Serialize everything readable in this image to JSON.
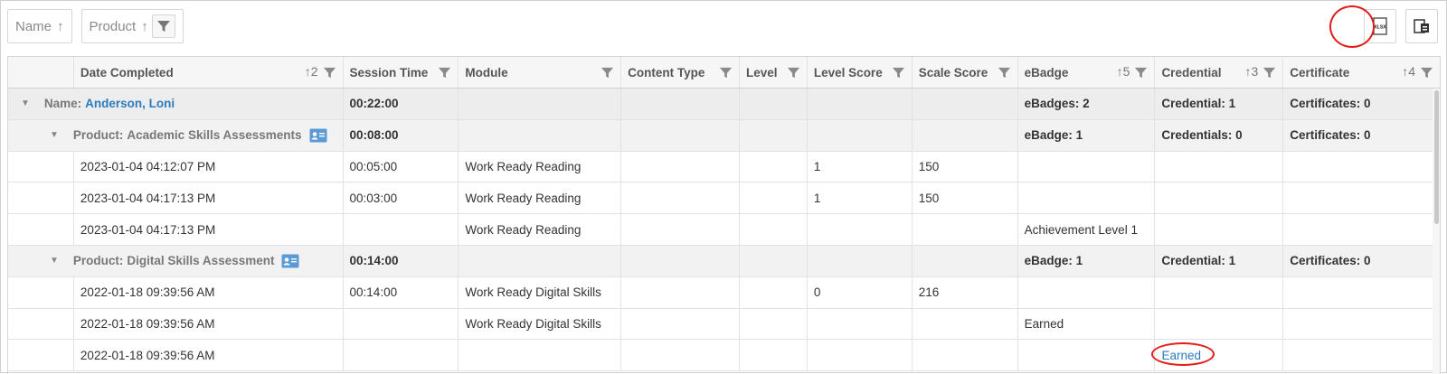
{
  "toolbar": {
    "group_chips": [
      {
        "label": "Name",
        "sort": "↑"
      },
      {
        "label": "Product",
        "sort": "↑"
      }
    ],
    "export_xlsx_label": "XLSX",
    "accent_circle_color": "#e31b1b"
  },
  "grid": {
    "columns": [
      {
        "label": "Date Completed",
        "sort": "↑2"
      },
      {
        "label": "Session Time",
        "sort": ""
      },
      {
        "label": "Module",
        "sort": ""
      },
      {
        "label": "Content Type",
        "sort": ""
      },
      {
        "label": "Level",
        "sort": ""
      },
      {
        "label": "Level Score",
        "sort": ""
      },
      {
        "label": "Scale Score",
        "sort": ""
      },
      {
        "label": "eBadge",
        "sort": "↑5"
      },
      {
        "label": "Credential",
        "sort": "↑3"
      },
      {
        "label": "Certificate",
        "sort": "↑4"
      }
    ],
    "name_group": {
      "prefix": "Name: ",
      "value": "Anderson, Loni",
      "session_time": "00:22:00",
      "ebadge": "eBadges: 2",
      "credential": "Credential: 1",
      "certificate": "Certificates: 0"
    },
    "product_groups": [
      {
        "prefix": "Product: ",
        "value": "Academic Skills Assessments",
        "session_time": "00:08:00",
        "ebadge": "eBadge: 1",
        "credential": "Credentials: 0",
        "certificate": "Certificates: 0",
        "rows": [
          {
            "date": "2023-01-04 04:12:07 PM",
            "session_time": "00:05:00",
            "module": "Work Ready Reading",
            "content_type": "",
            "level": "",
            "level_score": "1",
            "scale_score": "150",
            "ebadge": "",
            "credential": "",
            "certificate": ""
          },
          {
            "date": "2023-01-04 04:17:13 PM",
            "session_time": "00:03:00",
            "module": "Work Ready Reading",
            "content_type": "",
            "level": "",
            "level_score": "1",
            "scale_score": "150",
            "ebadge": "",
            "credential": "",
            "certificate": ""
          },
          {
            "date": "2023-01-04 04:17:13 PM",
            "session_time": "",
            "module": "Work Ready Reading",
            "content_type": "",
            "level": "",
            "level_score": "",
            "scale_score": "",
            "ebadge": "Achievement Level 1",
            "credential": "",
            "certificate": ""
          }
        ]
      },
      {
        "prefix": "Product: ",
        "value": "Digital Skills Assessment",
        "session_time": "00:14:00",
        "ebadge": "eBadge: 1",
        "credential": "Credential: 1",
        "certificate": "Certificates: 0",
        "rows": [
          {
            "date": "2022-01-18 09:39:56 AM",
            "session_time": "00:14:00",
            "module": "Work Ready Digital Skills",
            "content_type": "",
            "level": "",
            "level_score": "0",
            "scale_score": "216",
            "ebadge": "",
            "credential": "",
            "certificate": ""
          },
          {
            "date": "2022-01-18 09:39:56 AM",
            "session_time": "",
            "module": "Work Ready Digital Skills",
            "content_type": "",
            "level": "",
            "level_score": "",
            "scale_score": "",
            "ebadge": "Earned",
            "credential": "",
            "certificate": ""
          },
          {
            "date": "2022-01-18 09:39:56 AM",
            "session_time": "",
            "module": "",
            "content_type": "",
            "level": "",
            "level_score": "",
            "scale_score": "",
            "ebadge": "",
            "credential": "Earned",
            "certificate": ""
          }
        ]
      }
    ]
  }
}
